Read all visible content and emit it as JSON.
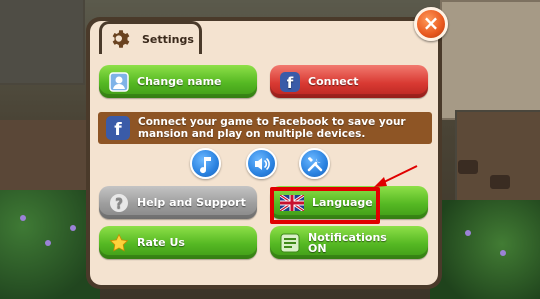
{
  "dialog": {
    "title": "Settings",
    "close_label": "×"
  },
  "buttons": {
    "change_name": "Change name",
    "connect": "Connect",
    "help": "Help and Support",
    "language": "Language",
    "rate": "Rate Us",
    "notifications_line1": "Notifications",
    "notifications_line2": "ON"
  },
  "facebook_banner": {
    "line1": "Connect your game to Facebook to save your",
    "line2": "mansion and play on multiple devices."
  },
  "toggles": [
    {
      "name": "music",
      "icon": "music-note-icon"
    },
    {
      "name": "sound",
      "icon": "speaker-icon"
    },
    {
      "name": "tools",
      "icon": "tools-icon"
    }
  ],
  "colors": {
    "panel": "#f4e3d0",
    "border": "#4a3a2a",
    "green": "#55b823",
    "red": "#d93a33",
    "gray": "#9d9d9d",
    "highlight": "#e00000",
    "banner": "#8e5525"
  }
}
